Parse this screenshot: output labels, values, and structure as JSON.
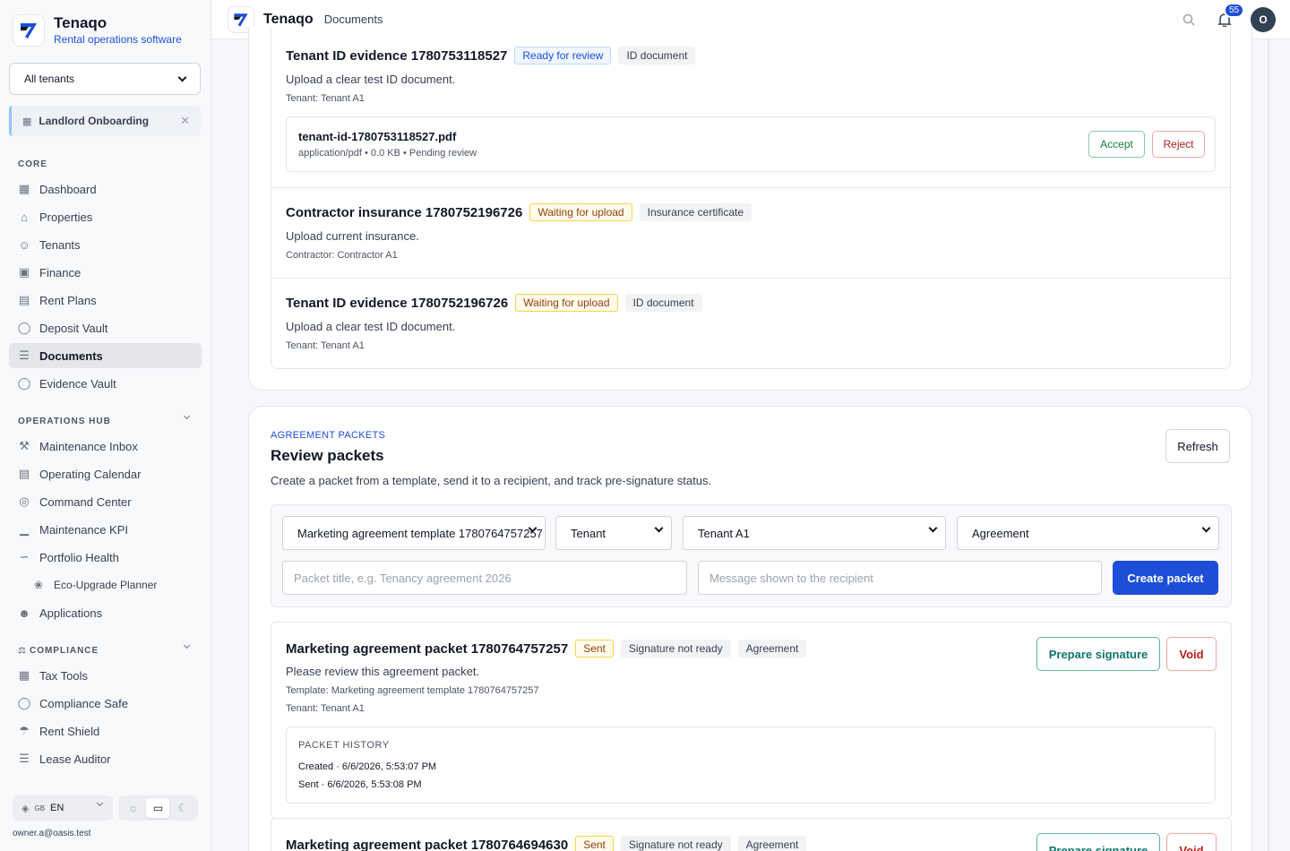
{
  "brand": {
    "name": "Tenaqo",
    "subtitle": "Rental operations software"
  },
  "tenant_filter": {
    "selected": "All tenants"
  },
  "onboarding": {
    "label": "Landlord Onboarding"
  },
  "sections": {
    "core": "CORE",
    "ops": "OPERATIONS HUB",
    "compliance": "COMPLIANCE"
  },
  "nav": {
    "core": [
      "Dashboard",
      "Properties",
      "Tenants",
      "Finance",
      "Rent Plans",
      "Deposit Vault",
      "Documents",
      "Evidence Vault"
    ],
    "ops": [
      "Maintenance Inbox",
      "Operating Calendar",
      "Command Center",
      "Maintenance KPI",
      "Portfolio Health",
      "Eco-Upgrade Planner",
      "Applications"
    ],
    "compliance": [
      "Tax Tools",
      "Compliance Safe",
      "Rent Shield",
      "Lease Auditor"
    ]
  },
  "footer": {
    "lang_flag": "GB",
    "lang": "EN",
    "email": "owner.a@oasis.test"
  },
  "topbar": {
    "title": "Tenaqo",
    "crumb": "Documents",
    "notifications": "55",
    "avatar": "O"
  },
  "requests": [
    {
      "title": "Tenant ID evidence 1780753118527",
      "status": "Ready for review",
      "type": "ID document",
      "desc": "Upload a clear test ID document.",
      "meta": "Tenant: Tenant A1",
      "file": {
        "name": "tenant-id-1780753118527.pdf",
        "meta": "application/pdf • 0.0 KB • Pending review",
        "accept": "Accept",
        "reject": "Reject"
      }
    },
    {
      "title": "Contractor insurance 1780752196726",
      "status": "Waiting for upload",
      "type": "Insurance certificate",
      "desc": "Upload current insurance.",
      "meta": "Contractor: Contractor A1"
    },
    {
      "title": "Tenant ID evidence 1780752196726",
      "status": "Waiting for upload",
      "type": "ID document",
      "desc": "Upload a clear test ID document.",
      "meta": "Tenant: Tenant A1"
    }
  ],
  "packets_section": {
    "eyebrow": "AGREEMENT PACKETS",
    "title": "Review packets",
    "lead": "Create a packet from a template, send it to a recipient, and track pre-signature status.",
    "refresh": "Refresh",
    "form": {
      "template": "Marketing agreement template 1780764757257",
      "recipient_type": "Tenant",
      "recipient": "Tenant A1",
      "kind": "Agreement",
      "title_placeholder": "Packet title, e.g. Tenancy agreement 2026",
      "message_placeholder": "Message shown to the recipient",
      "create": "Create packet"
    },
    "packets": [
      {
        "title": "Marketing agreement packet 1780764757257",
        "status": "Sent",
        "sig": "Signature not ready",
        "kind": "Agreement",
        "desc": "Please review this agreement packet.",
        "template": "Template: Marketing agreement template 1780764757257",
        "tenant": "Tenant: Tenant A1",
        "prepare": "Prepare signature",
        "void": "Void",
        "history_title": "PACKET HISTORY",
        "history": [
          "Created · 6/6/2026, 5:53:07 PM",
          "Sent · 6/6/2026, 5:53:08 PM"
        ]
      },
      {
        "title": "Marketing agreement packet 1780764694630",
        "status": "Sent",
        "sig": "Signature not ready",
        "kind": "Agreement",
        "prepare": "Prepare signature",
        "void": "Void"
      }
    ]
  }
}
